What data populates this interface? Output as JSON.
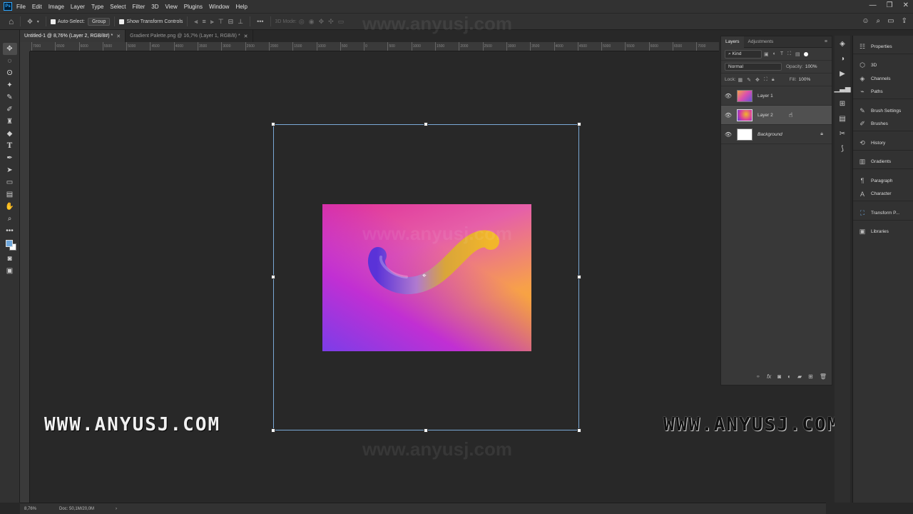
{
  "app": {
    "menu": [
      "File",
      "Edit",
      "Image",
      "Layer",
      "Type",
      "Select",
      "Filter",
      "3D",
      "View",
      "Plugins",
      "Window",
      "Help"
    ],
    "logo_text": "Ps"
  },
  "options_bar": {
    "auto_select_label": "Auto-Select:",
    "group_value": "Group",
    "show_transform_label": "Show Transform Controls",
    "mode_3d_label": "3D Mode:"
  },
  "tabs": [
    {
      "label": "Untitled-1 @ 8,76% (Layer 2, RGB/8#) *",
      "active": true
    },
    {
      "label": "Gradient Palette.png @ 16,7% (Layer 1, RGB/8) *",
      "active": false
    }
  ],
  "ruler": {
    "ticks": [
      "7000",
      "6500",
      "6000",
      "5500",
      "5000",
      "4500",
      "4000",
      "3500",
      "3000",
      "2500",
      "2000",
      "1500",
      "1000",
      "500",
      "0",
      "500",
      "1000",
      "1500",
      "2000",
      "2500",
      "3000",
      "3500",
      "4000",
      "4500",
      "5000",
      "5500",
      "6000",
      "6500",
      "7000"
    ]
  },
  "watermarks": {
    "left": "WWW.ANYUSJ.COM",
    "right": "WWW.ANYUSJ.COM",
    "faint": "www.anyusj.com"
  },
  "status": {
    "zoom": "8,76%",
    "doc": "Doc: 50,1M/20,0M"
  },
  "layers_panel": {
    "tab_layers": "Layers",
    "tab_adjustments": "Adjustments",
    "filter_kind": "Kind",
    "blend_mode": "Normal",
    "opacity_label": "Opacity:",
    "opacity_value": "100%",
    "lock_label": "Lock:",
    "fill_label": "Fill:",
    "fill_value": "100%",
    "layers": [
      {
        "name": "Layer 1",
        "selected": false
      },
      {
        "name": "Layer 2",
        "selected": true
      },
      {
        "name": "Background",
        "selected": false
      }
    ]
  },
  "right_panels": {
    "items": [
      "Properties",
      "3D",
      "Channels",
      "Paths",
      "Brush Settings",
      "Brushes",
      "History",
      "Gradients",
      "Paragraph",
      "Character",
      "Transform P...",
      "Libraries"
    ]
  }
}
